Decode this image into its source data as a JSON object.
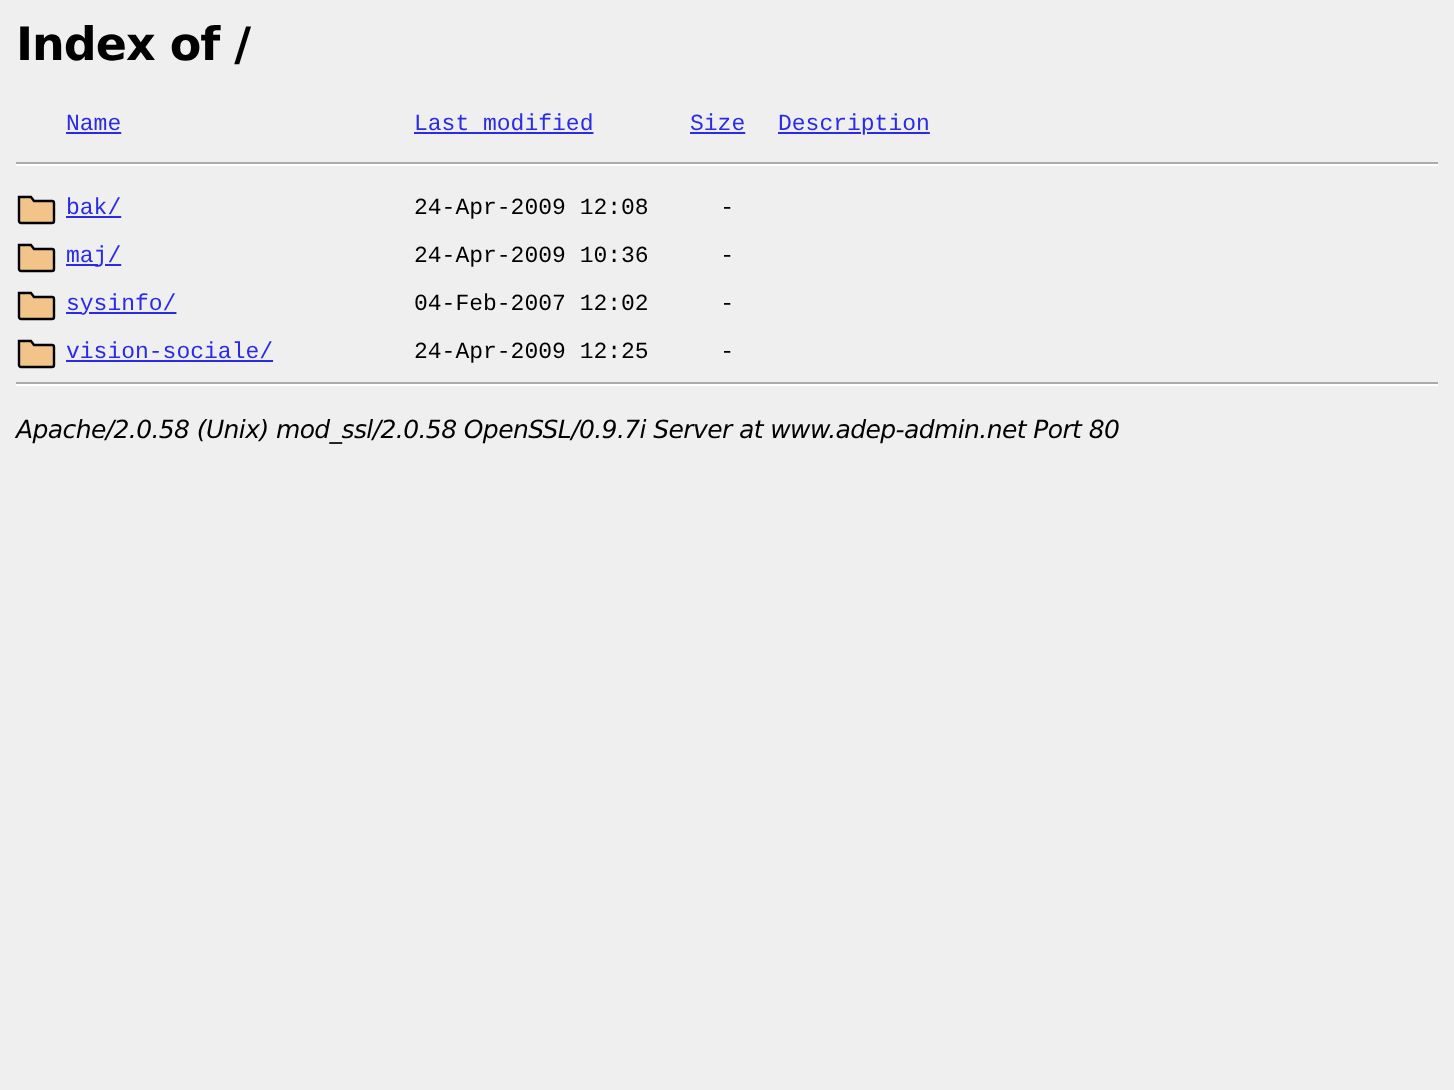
{
  "title": "Index of /",
  "columns": [
    "Name",
    "Last modified",
    "Size",
    "Description"
  ],
  "rows": [
    {
      "name": "bak/",
      "modified": "24-Apr-2009 12:08",
      "size": "-"
    },
    {
      "name": "maj/",
      "modified": "24-Apr-2009 10:36",
      "size": "-"
    },
    {
      "name": "sysinfo/",
      "modified": "04-Feb-2007 12:02",
      "size": "-"
    },
    {
      "name": "vision-sociale/",
      "modified": "24-Apr-2009 12:25",
      "size": "-"
    }
  ],
  "address": "Apache/2.0.58 (Unix) mod_ssl/2.0.58 OpenSSL/0.9.7i Server at www.adep-admin.net Port 80"
}
